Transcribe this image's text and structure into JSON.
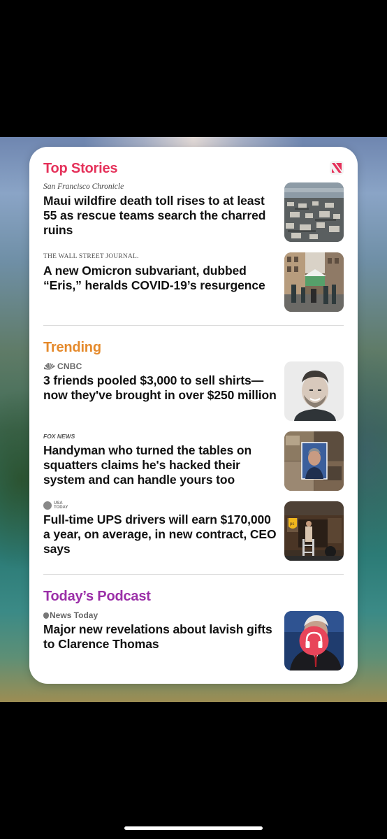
{
  "app": "Apple News Widget",
  "sections": {
    "top_stories": {
      "title": "Top Stories",
      "stories": [
        {
          "source": "San Francisco Chronicle",
          "headline": "Maui wildfire death toll rises to at least 55 as rescue teams search the charred ruins",
          "thumb": "aerial-burned-town"
        },
        {
          "source": "THE WALL STREET JOURNAL.",
          "headline": "A new Omicron subvariant, dubbed “Eris,” heralds COVID-19’s resurgence",
          "thumb": "street-testing-tent"
        }
      ]
    },
    "trending": {
      "title": "Trending",
      "stories": [
        {
          "source": "CNBC",
          "headline": "3 friends pooled $3,000 to sell shirts—now they've brought in over $250 million",
          "thumb": "man-portrait"
        },
        {
          "source": "FOX NEWS",
          "headline": "Handyman who turned the tables on squatters claims he's hacked their system and can handle yours too",
          "thumb": "messy-house-inset"
        },
        {
          "source_line1": "USA",
          "source_line2": "TODAY",
          "headline": "Full-time UPS drivers will earn $170,000 a year, on average, in new contract, CEO says",
          "thumb": "ups-truck"
        }
      ]
    },
    "podcast": {
      "title": "Today’s Podcast",
      "source": "News Today",
      "headline": "Major new revelations about lavish gifts to Clarence Thomas",
      "thumb": "justice-headphones-icon"
    }
  },
  "colors": {
    "top_stories": "#e5315a",
    "trending": "#e58a2c",
    "podcast": "#9b2fa8",
    "headphone_badge": "#e8455a"
  },
  "icons": [
    "apple-news-logo",
    "cnbc-peacock-icon",
    "usa-today-dot-icon",
    "apple-logo-icon",
    "headphones-icon"
  ]
}
